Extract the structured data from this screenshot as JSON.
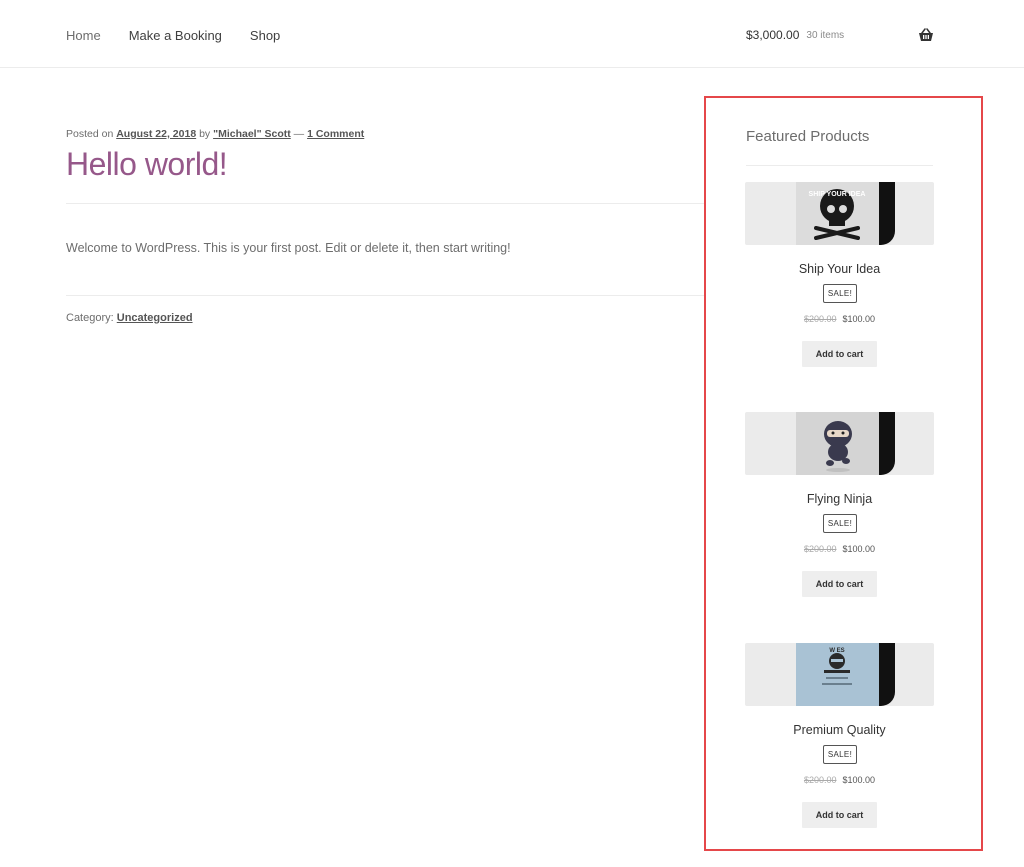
{
  "nav": {
    "items": [
      {
        "label": "Home"
      },
      {
        "label": "Make a Booking"
      },
      {
        "label": "Shop"
      }
    ]
  },
  "cart": {
    "amount": "$3,000.00",
    "count": "30 items",
    "icon": "basket-icon"
  },
  "post": {
    "meta_prefix": "Posted on ",
    "date": "August 22, 2018",
    "by": " by ",
    "author": "\"Michael\" Scott",
    "sep": " — ",
    "comments": "1 Comment",
    "title": "Hello world!",
    "body": "Welcome to WordPress. This is your first post. Edit or delete it, then start writing!",
    "category_label": "Category: ",
    "category": "Uncategorized"
  },
  "widget": {
    "title": "Featured Products",
    "products": [
      {
        "name": "Ship Your Idea",
        "sale": "SALE!",
        "old_price": "$200.00",
        "new_price": "$100.00",
        "button": "Add to cart",
        "thumb_text": "SHIP YOUR IDEA"
      },
      {
        "name": "Flying Ninja",
        "sale": "SALE!",
        "old_price": "$200.00",
        "new_price": "$100.00",
        "button": "Add to cart"
      },
      {
        "name": "Premium Quality",
        "sale": "SALE!",
        "old_price": "$200.00",
        "new_price": "$100.00",
        "button": "Add to cart",
        "thumb_text": "W                ES"
      }
    ]
  },
  "colors": {
    "accent": "#96588a",
    "highlight": "#e5474a"
  }
}
